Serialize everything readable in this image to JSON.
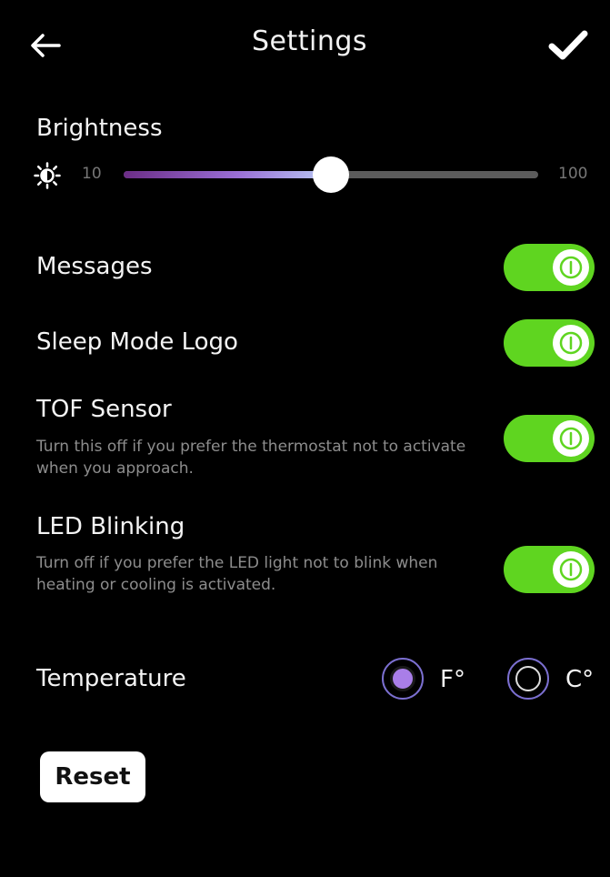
{
  "header": {
    "title": "Settings",
    "back_icon": "arrow-left-icon",
    "confirm_icon": "checkmark-icon"
  },
  "brightness": {
    "label": "Brightness",
    "icon": "sun-icon",
    "min_label": "10",
    "max_label": "100",
    "value_fraction": 0.5,
    "fill_gradient": [
      "#6b2d86",
      "#9a6fd6",
      "#b8c9f3"
    ]
  },
  "toggles": [
    {
      "label": "Messages",
      "description": "",
      "on": true
    },
    {
      "label": "Sleep Mode Logo",
      "description": "",
      "on": true
    },
    {
      "label": "TOF Sensor",
      "description": "Turn this off if you prefer the thermostat not to activate when you approach.",
      "on": true
    },
    {
      "label": "LED Blinking",
      "description": "Turn off if you prefer the LED light not to blink when heating or cooling is activated.",
      "on": true
    }
  ],
  "temperature": {
    "label": "Temperature",
    "options": [
      {
        "label": "F°",
        "selected": true
      },
      {
        "label": "C°",
        "selected": false
      }
    ]
  },
  "reset_label": "Reset",
  "colors": {
    "background": "#000000",
    "toggle_on": "#5fd520",
    "radio_selected": "#a97ee8"
  }
}
